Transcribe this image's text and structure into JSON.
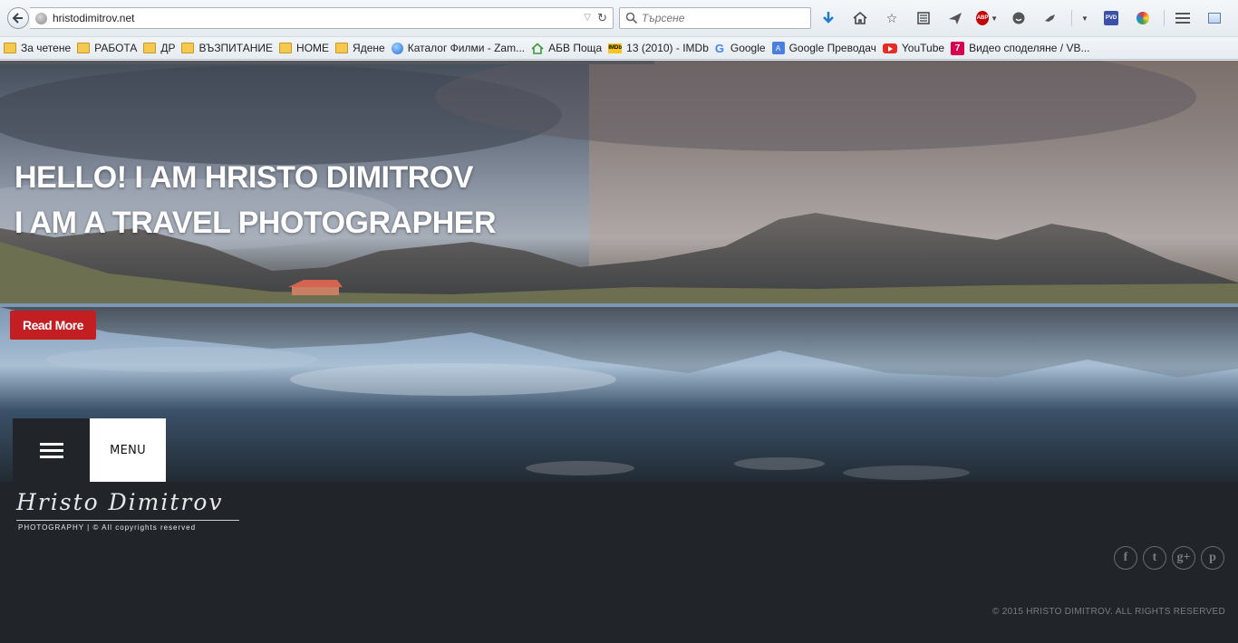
{
  "browser": {
    "url": "hristodimitrov.net",
    "search_placeholder": "Търсене",
    "toolbar": {
      "icons": [
        "download-icon",
        "home-icon",
        "bookmark-star-icon",
        "reading-list-icon",
        "send-icon",
        "adblock-icon",
        "chat-icon",
        "extension-icon",
        "pvd-icon",
        "colorful-extension-icon",
        "hamburger-menu-icon",
        "screenshot-icon"
      ],
      "abp_text": "ABP",
      "pvd_text": "PVD"
    },
    "bookmarks": [
      {
        "label": "За четене",
        "icon": "folder-icon"
      },
      {
        "label": "РАБОТА",
        "icon": "folder-icon"
      },
      {
        "label": "ДР",
        "icon": "folder-icon"
      },
      {
        "label": "ВЪЗПИТАНИЕ",
        "icon": "folder-icon"
      },
      {
        "label": "HOME",
        "icon": "folder-icon"
      },
      {
        "label": "Ядене",
        "icon": "folder-icon"
      },
      {
        "label": "Каталог Филми - Zam...",
        "icon": "web-icon"
      },
      {
        "label": "АБВ Поща",
        "icon": "home-icon"
      },
      {
        "label": "13 (2010) - IMDb",
        "icon": "imdb-icon",
        "icon_text": "IMDb"
      },
      {
        "label": "Google",
        "icon": "google-icon",
        "icon_text": "G"
      },
      {
        "label": "Google Преводач",
        "icon": "translate-icon",
        "icon_text": "A"
      },
      {
        "label": "YouTube",
        "icon": "youtube-icon"
      },
      {
        "label": "Видео споделяне / VB...",
        "icon": "seven-icon",
        "icon_text": "7"
      }
    ]
  },
  "hero": {
    "title_line1": "HELLO! I AM HRISTO DIMITROV",
    "title_line2": "I AM A TRAVEL PHOTOGRAPHER",
    "read_more": "Read More",
    "menu_label": "MENU"
  },
  "footer": {
    "logo_script": "Hristo Dimitrov",
    "logo_sub": "PHOTOGRAPHY | © All copyrights reserved",
    "socials": [
      {
        "name": "facebook-icon",
        "glyph": "f"
      },
      {
        "name": "twitter-icon",
        "glyph": "t"
      },
      {
        "name": "google-plus-icon",
        "glyph": "g+"
      },
      {
        "name": "pinterest-icon",
        "glyph": "p"
      }
    ],
    "copyright": "© 2015 HRISTO DIMITROV. ALL RIGHTS RESERVED"
  },
  "colors": {
    "accent_red": "#c31f23",
    "footer_bg": "#212429",
    "hero_text": "#ffffff"
  }
}
